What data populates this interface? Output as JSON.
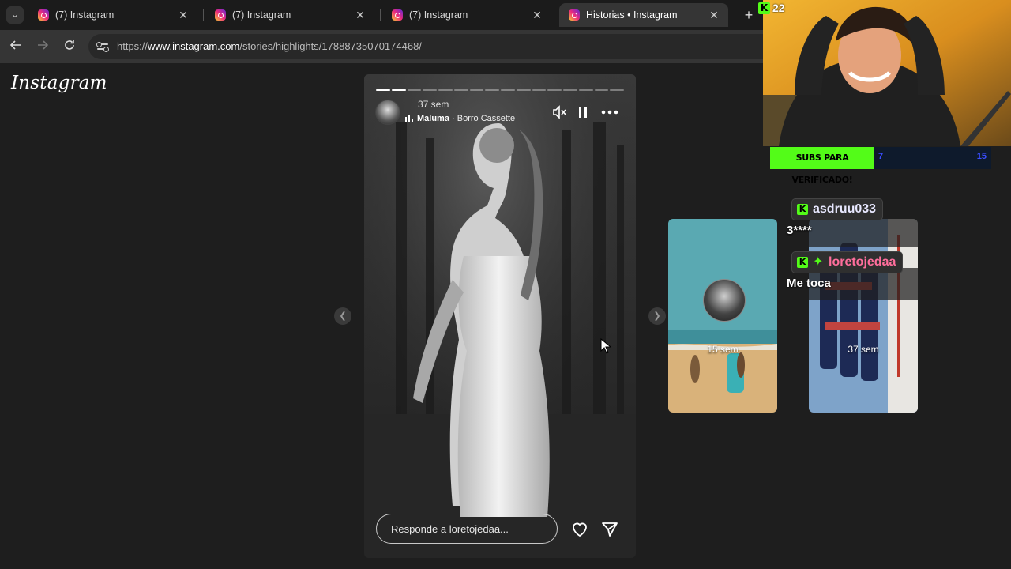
{
  "browser": {
    "tabs": [
      {
        "title": "(7) Instagram",
        "active": false
      },
      {
        "title": "(7) Instagram",
        "active": false
      },
      {
        "title": "(7) Instagram",
        "active": false
      },
      {
        "title": "Historias • Instagram",
        "active": true
      }
    ],
    "close_glyph": "✕",
    "new_tab_glyph": "+",
    "url_prefix": "https://",
    "url_host": "www.instagram.com",
    "url_path": "/stories/highlights/17888735070174468/"
  },
  "page": {
    "logo": "Instagram",
    "story": {
      "time": "37 sem",
      "artist": "Maluma",
      "song_separator": " · ",
      "song": "Borro Cassette",
      "segments_total": 16,
      "segments_done": 2,
      "reply_placeholder": "Responde a loretojedaa..."
    },
    "previews": [
      {
        "time": "15 sem"
      },
      {
        "time": "37 sem"
      }
    ]
  },
  "stream": {
    "viewer_count": "22",
    "goal_label": "SUBS PARA VERIFICADO!",
    "goal_current": "7",
    "goal_target": "15",
    "chat": [
      {
        "user": "asdruu033",
        "text": "3****",
        "name_color": "#e8e8ff"
      },
      {
        "user": "loretojedaa",
        "text": "Me toca",
        "name_color": "#ff6e9c"
      }
    ]
  },
  "colors": {
    "kick_green": "#53fc18",
    "chrome_dark": "#1b1b1b",
    "chrome_toolbar": "#353535",
    "page_bg": "#1e1e1e"
  }
}
